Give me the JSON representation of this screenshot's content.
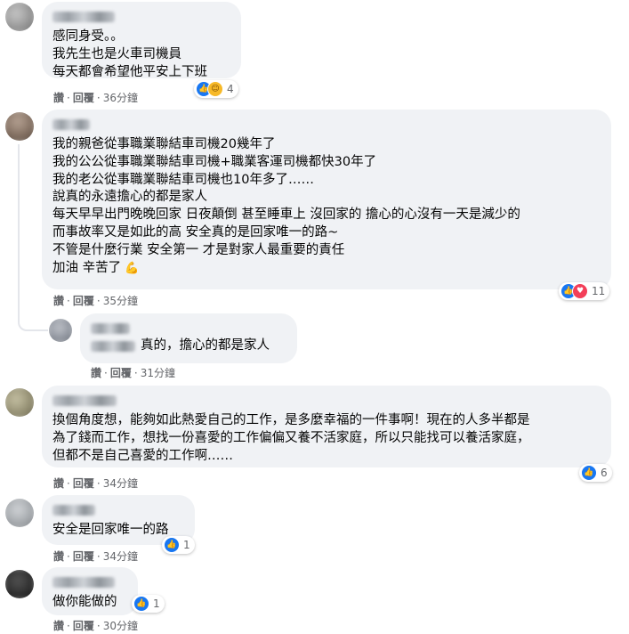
{
  "actions": {
    "like": "讚",
    "reply": "回覆",
    "sep": "·"
  },
  "comments": [
    {
      "lines": [
        "感同身受。。",
        "我先生也是火車司機員",
        "每天都會希望他平安上下班"
      ],
      "time": "36分鐘",
      "reaction_icons": [
        "like-icon",
        "care-icon"
      ],
      "reaction_count": "4",
      "avatar_color": "#9a9a9a"
    },
    {
      "lines": [
        "我的親爸從事職業聯結車司機20幾年了",
        "我的公公從事職業聯結車司機+職業客運司機都快30年了",
        "我的老公從事職業聯結車司機也10年多了……",
        "說真的永遠擔心的都是家人",
        "每天早早出門晚晚回家 日夜顛倒 甚至睡車上 沒回家的 擔心的心沒有一天是減少的",
        "而事故率又是如此的高 安全真的是回家唯一的路~",
        "不管是什麼行業 安全第一 才是對家人最重要的責任",
        "加油 辛苦了"
      ],
      "emoji": "💪",
      "time": "35分鐘",
      "reaction_icons": [
        "like-icon",
        "love-icon"
      ],
      "reaction_count": "11",
      "avatar_color": "#7d6a5c"
    },
    {
      "lines": [
        "真的，擔心的都是家人"
      ],
      "time": "31分鐘",
      "avatar_color": "#8a8f99"
    },
    {
      "lines": [
        "換個角度想，能夠如此熱愛自己的工作，是多麼幸福的一件事啊！現在的人多半都是",
        "為了錢而工作，想找一份喜愛的工作偏偏又養不活家庭，所以只能找可以養活家庭，",
        "但都不是自己喜愛的工作啊……"
      ],
      "time": "34分鐘",
      "reaction_icons": [
        "like-icon"
      ],
      "reaction_count": "6",
      "avatar_color": "#8f8a6e"
    },
    {
      "lines": [
        "安全是回家唯一的路"
      ],
      "time": "34分鐘",
      "reaction_icons": [
        "like-icon"
      ],
      "reaction_count": "1",
      "avatar_color": "#a0a4a8"
    },
    {
      "lines": [
        "做你能做的"
      ],
      "time": "30分鐘",
      "reaction_icons": [
        "like-icon"
      ],
      "reaction_count": "1",
      "avatar_color": "#2a2a2a"
    }
  ]
}
